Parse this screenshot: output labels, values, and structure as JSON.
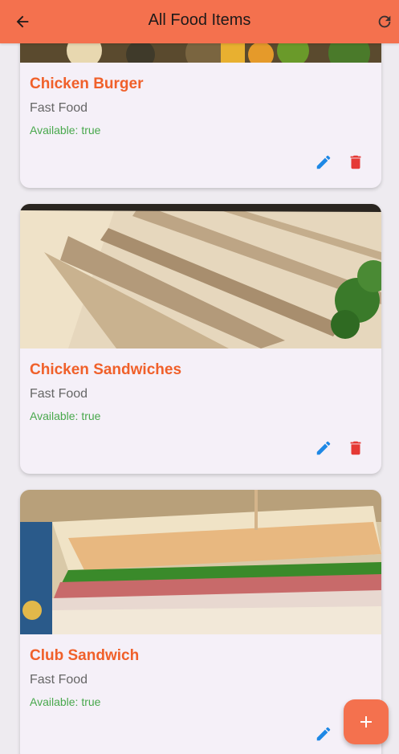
{
  "appbar": {
    "title": "All Food Items",
    "back_icon": "arrow-back-icon",
    "refresh_icon": "refresh-icon"
  },
  "colors": {
    "primary": "#f4714e",
    "title_text": "#f0602a",
    "available_text": "#48a84c",
    "edit_icon": "#1e88e5",
    "delete_icon": "#e53935",
    "card_bg": "#f5f0f8"
  },
  "items": [
    {
      "name": "Chicken Burger",
      "category": "Fast Food",
      "available": "Available: true"
    },
    {
      "name": "Chicken Sandwiches",
      "category": "Fast Food",
      "available": "Available: true"
    },
    {
      "name": "Club Sandwich",
      "category": "Fast Food",
      "available": "Available: true"
    }
  ],
  "fab_icon": "add-icon"
}
